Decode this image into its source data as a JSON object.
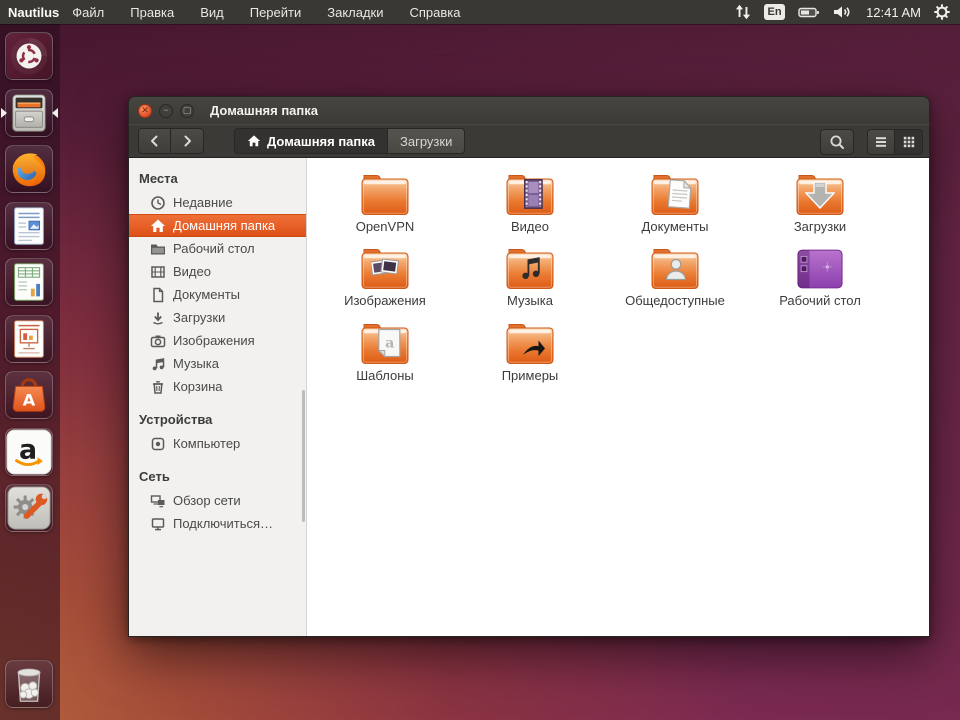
{
  "colors": {
    "accent_orange": "#dd4814",
    "selection_gradient_top": "#ee7039",
    "selection_gradient_bottom": "#de5117",
    "titlebar": "#3c3a36",
    "sidebar_bg": "#f2f1ef",
    "menubar_bg": "#3a3833"
  },
  "menubar": {
    "app_name": "Nautilus",
    "menus": [
      "Файл",
      "Правка",
      "Вид",
      "Перейти",
      "Закладки",
      "Справка"
    ],
    "keyboard_layout": "En",
    "time": "12:41 AM",
    "indicator_icons": [
      "network-arrows-icon",
      "keyboard-layout-indicator",
      "battery-icon",
      "volume-icon",
      "session-gear-icon"
    ]
  },
  "launcher": [
    {
      "name": "ubuntu-dash-icon",
      "active": false
    },
    {
      "name": "files-icon",
      "active": true
    },
    {
      "name": "firefox-icon",
      "active": false
    },
    {
      "name": "libreoffice-writer-icon",
      "active": false
    },
    {
      "name": "libreoffice-calc-icon",
      "active": false
    },
    {
      "name": "libreoffice-impress-icon",
      "active": false
    },
    {
      "name": "ubuntu-software-center-icon",
      "active": false
    },
    {
      "name": "amazon-icon",
      "active": false
    },
    {
      "name": "system-settings-icon",
      "active": false
    },
    {
      "name": "trash-icon",
      "active": false
    }
  ],
  "window": {
    "title": "Домашняя папка",
    "controls": [
      "close",
      "minimize",
      "maximize"
    ],
    "toolbar": {
      "breadcrumbs": [
        {
          "label": "Домашняя папка",
          "icon": "home-icon",
          "active": true
        },
        {
          "label": "Загрузки",
          "active": false
        }
      ],
      "view_buttons": [
        {
          "name": "search-button",
          "icon": "search-icon",
          "active": false
        },
        {
          "name": "list-view-button",
          "icon": "list-view-icon",
          "active": false
        },
        {
          "name": "grid-view-button",
          "icon": "grid-view-icon",
          "active": true
        }
      ]
    },
    "sidebar": {
      "sections": [
        {
          "header": "Места",
          "items": [
            {
              "label": "Недавние",
              "icon": "clock-icon",
              "selected": false
            },
            {
              "label": "Домашняя папка",
              "icon": "home-icon",
              "selected": true
            },
            {
              "label": "Рабочий стол",
              "icon": "desktop-folder-icon",
              "selected": false
            },
            {
              "label": "Видео",
              "icon": "film-icon",
              "selected": false
            },
            {
              "label": "Документы",
              "icon": "document-icon",
              "selected": false
            },
            {
              "label": "Загрузки",
              "icon": "download-icon",
              "selected": false
            },
            {
              "label": "Изображения",
              "icon": "camera-icon",
              "selected": false
            },
            {
              "label": "Музыка",
              "icon": "music-icon",
              "selected": false
            },
            {
              "label": "Корзина",
              "icon": "trash-icon",
              "selected": false
            }
          ]
        },
        {
          "header": "Устройства",
          "items": [
            {
              "label": "Компьютер",
              "icon": "drive-icon",
              "selected": false
            }
          ]
        },
        {
          "header": "Сеть",
          "items": [
            {
              "label": "Обзор сети",
              "icon": "network-icon",
              "selected": false
            },
            {
              "label": "Подключиться…",
              "icon": "monitor-icon",
              "selected": false
            }
          ]
        }
      ]
    },
    "files": [
      {
        "label": "OpenVPN",
        "kind": "folder",
        "emblem": null
      },
      {
        "label": "Видео",
        "kind": "folder",
        "emblem": "film"
      },
      {
        "label": "Документы",
        "kind": "folder",
        "emblem": "doc"
      },
      {
        "label": "Загрузки",
        "kind": "folder",
        "emblem": "download"
      },
      {
        "label": "Изображения",
        "kind": "folder",
        "emblem": "photos"
      },
      {
        "label": "Музыка",
        "kind": "folder",
        "emblem": "music"
      },
      {
        "label": "Общедоступные",
        "kind": "folder",
        "emblem": "person"
      },
      {
        "label": "Рабочий стол",
        "kind": "desktop",
        "emblem": null
      },
      {
        "label": "Шаблоны",
        "kind": "folder",
        "emblem": "template"
      },
      {
        "label": "Примеры",
        "kind": "folder",
        "emblem": "shortcut"
      }
    ]
  }
}
